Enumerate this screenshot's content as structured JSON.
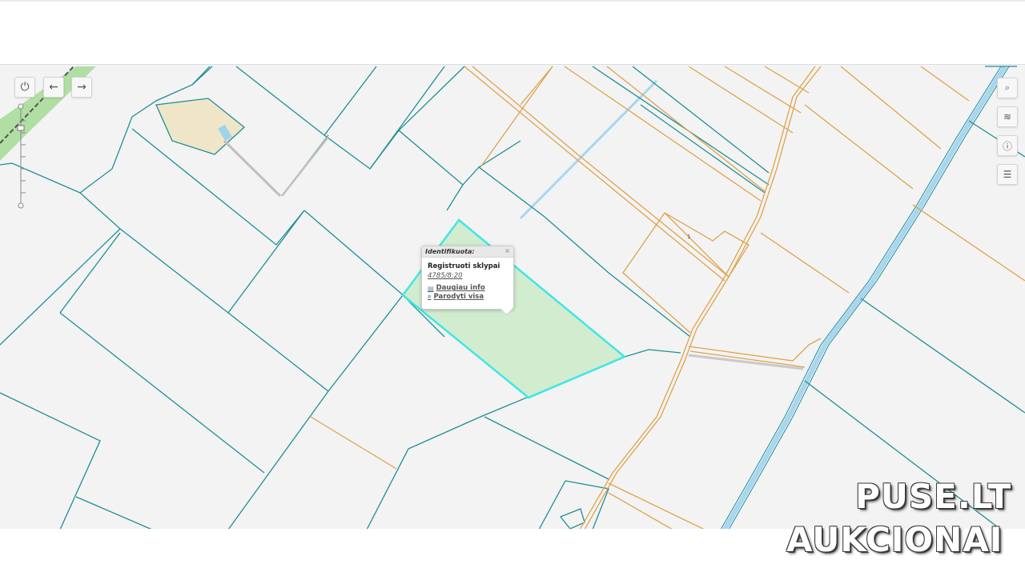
{
  "map": {
    "popup": {
      "header": "Identifikuota:",
      "close_glyph": "×",
      "title": "Registruoti sklypai",
      "parcel_id": "4785/8:20",
      "link_more": "Daugiau info",
      "link_show": "Parodyti visa"
    },
    "parcel_label": "1",
    "colors": {
      "parcel_boundary": "#1e8f96",
      "road_line": "#e0a24a",
      "highlight_fill": "#cdebcb",
      "highlight_stroke": "#3fe6e6",
      "water": "#9fd3ea"
    },
    "controls_left": [
      "power-icon",
      "arrow-left-icon",
      "arrow-right-icon"
    ],
    "controls_right": [
      "search-icon",
      "layers-icon",
      "info-icon",
      "document-icon"
    ]
  },
  "watermark": {
    "line1": "PUSE.LT",
    "line2": "AUKCIONAI"
  }
}
